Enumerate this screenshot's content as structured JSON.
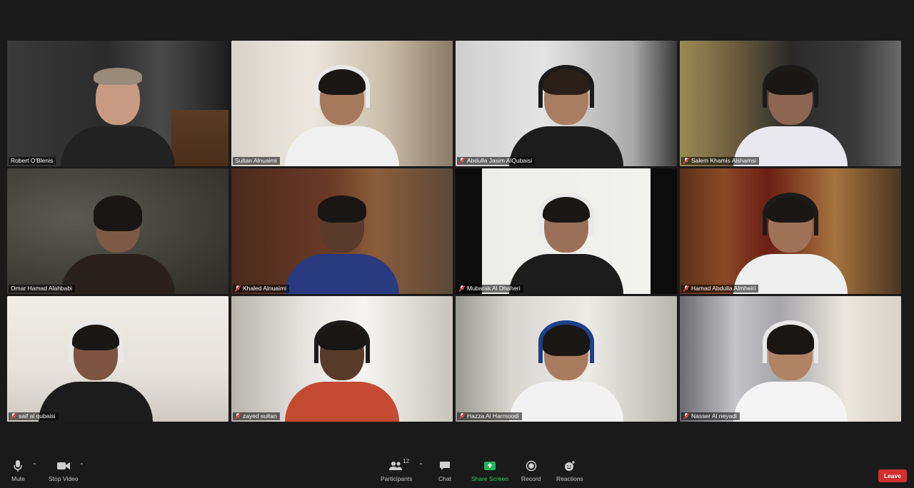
{
  "meeting": {
    "participants": [
      {
        "name": "Robert O'Blenis",
        "muted": false,
        "active_speaker": true,
        "bg": "room-dark"
      },
      {
        "name": "Sultan Alnuaimi",
        "muted": false,
        "active_speaker": false,
        "bg": "room-light"
      },
      {
        "name": "Abdulla Jasim AlQubaisi",
        "muted": true,
        "active_speaker": false,
        "bg": "grey"
      },
      {
        "name": "Salem Khamis Alshamsi",
        "muted": true,
        "active_speaker": false,
        "bg": "dark-room"
      },
      {
        "name": "Omar Hamad Alahbabi",
        "muted": false,
        "active_speaker": false,
        "bg": "wall"
      },
      {
        "name": "Khaled Alnuaimi",
        "muted": true,
        "active_speaker": false,
        "bg": "wood"
      },
      {
        "name": "Mubarak Al Dhaheri",
        "muted": true,
        "active_speaker": false,
        "bg": "white"
      },
      {
        "name": "Hamad Abdulla Almheiri",
        "muted": true,
        "active_speaker": false,
        "bg": "curtain"
      },
      {
        "name": "saif al qubaisi",
        "muted": true,
        "active_speaker": false,
        "bg": "pale"
      },
      {
        "name": "zayed sultan",
        "muted": true,
        "active_speaker": false,
        "bg": "window"
      },
      {
        "name": "Hazza Al Harmoodi",
        "muted": true,
        "active_speaker": false,
        "bg": "bright"
      },
      {
        "name": "Nasser Al neyadi",
        "muted": true,
        "active_speaker": false,
        "bg": "curtain-light"
      }
    ]
  },
  "toolbar": {
    "mute_label": "Mute",
    "stop_video_label": "Stop Video",
    "participants_label": "Participants",
    "participants_count": "12",
    "chat_label": "Chat",
    "share_label": "Share Screen",
    "record_label": "Record",
    "reactions_label": "Reactions",
    "leave_label": "Leave",
    "icons": {
      "mute": "microphone-icon",
      "video": "video-camera-icon",
      "participants": "people-icon",
      "chat": "chat-bubble-icon",
      "share": "share-screen-icon",
      "record": "record-icon",
      "reactions": "emoji-icon"
    }
  },
  "colors": {
    "active_border": "#d4dd6a",
    "share_green": "#2dd26a",
    "leave_red": "#d22f2f",
    "background": "#1a1a1a"
  }
}
